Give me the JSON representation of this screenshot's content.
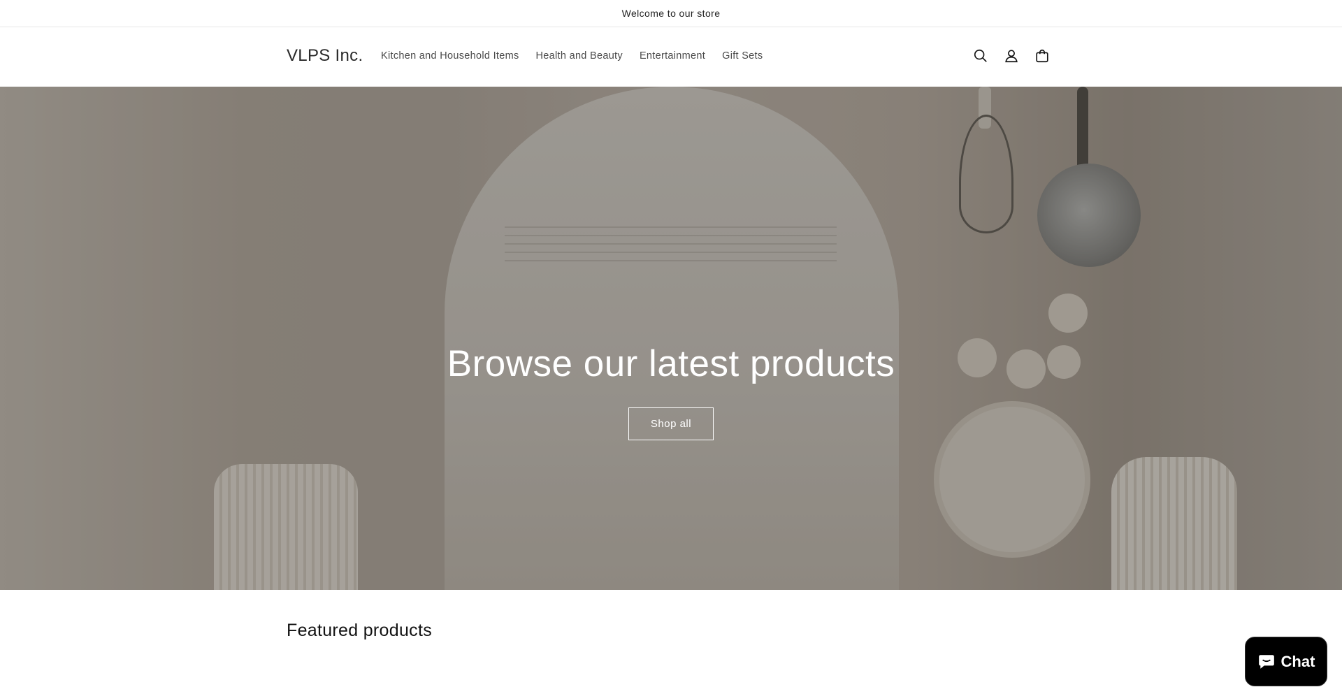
{
  "announcement": {
    "text": "Welcome to our store"
  },
  "header": {
    "logo": "VLPS Inc.",
    "nav": [
      {
        "label": "Kitchen and Household Items"
      },
      {
        "label": "Health and Beauty"
      },
      {
        "label": "Entertainment"
      },
      {
        "label": "Gift Sets"
      }
    ],
    "icons": [
      "search-icon",
      "account-icon",
      "cart-icon"
    ]
  },
  "hero": {
    "title": "Browse our latest products",
    "button_label": "Shop all"
  },
  "featured": {
    "title": "Featured products"
  },
  "chat": {
    "label": "Chat",
    "icon": "chat-bubble-icon"
  },
  "colors": {
    "text": "#121212",
    "hero_overlay": "rgba(0,0,0,0.28)",
    "chat_bg": "#000000"
  }
}
